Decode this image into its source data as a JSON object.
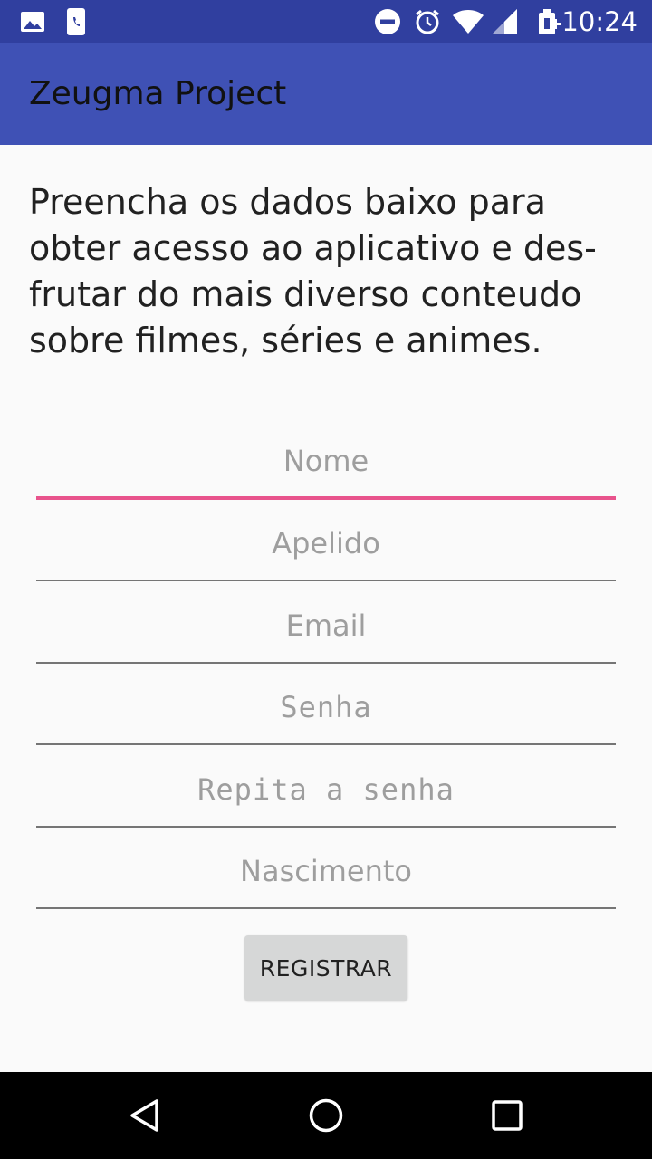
{
  "status_bar": {
    "time": "10:24",
    "left_icons": [
      "image-icon",
      "phone-notification-icon"
    ],
    "right_icons": [
      "do-not-disturb-icon",
      "alarm-icon",
      "wifi-icon",
      "signal-icon",
      "battery-charging-icon"
    ]
  },
  "app_bar": {
    "title": "Zeugma Project",
    "color": "#3f51b5"
  },
  "intro_text": "Preencha os dados baixo para obter acesso ao aplicativo e des-frutar do mais diverso conteudo sobre filmes, séries e animes.",
  "form": {
    "fields": {
      "nome": {
        "placeholder": "Nome",
        "value": ""
      },
      "apelido": {
        "placeholder": "Apelido",
        "value": ""
      },
      "email": {
        "placeholder": "Email",
        "value": ""
      },
      "senha": {
        "placeholder": "Senha",
        "value": ""
      },
      "repita_senha": {
        "placeholder": "Repita a senha",
        "value": ""
      },
      "nascimento": {
        "placeholder": "Nascimento",
        "value": ""
      }
    },
    "focused_field": "nome",
    "accent_color": "#e8538c",
    "register_label": "REGISTRAR"
  },
  "nav_bar": {
    "buttons": [
      "back-icon",
      "home-icon",
      "recents-icon"
    ]
  }
}
